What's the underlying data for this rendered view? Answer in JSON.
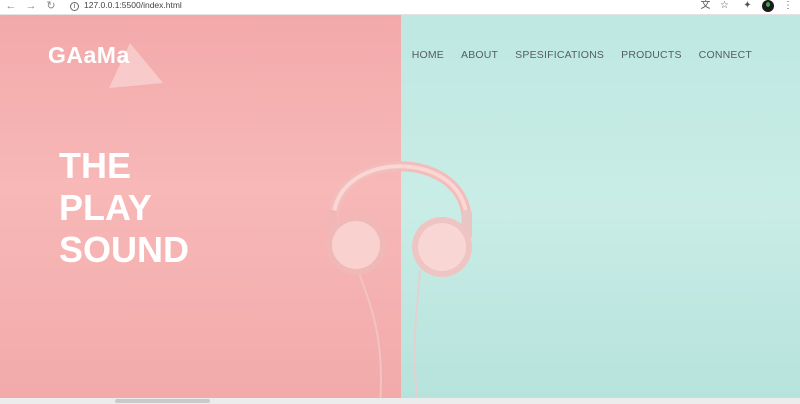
{
  "browser": {
    "url": "127.0.0.1:5500/index.html",
    "back_icon": "arrow-left-icon",
    "forward_icon": "arrow-right-icon",
    "reload_icon": "reload-icon",
    "info_icon": "info-icon",
    "translate_icon": "translate-icon",
    "bookmark_icon": "star-icon",
    "extensions_icon": "puzzle-icon",
    "menu_icon": "kebab-menu-icon"
  },
  "site": {
    "logo": "GAaMa",
    "nav": [
      "HOME",
      "ABOUT",
      "SPESIFICATIONS",
      "PRODUCTS",
      "CONNECT"
    ],
    "headline": [
      "THE",
      "PLAY",
      "SOUND"
    ],
    "colors": {
      "left_bg": "#f5b1b1",
      "right_bg": "#c2e9e3",
      "headphone": "#f4c8c6",
      "logo": "#ffffff",
      "nav_text": "#555e5c"
    }
  }
}
